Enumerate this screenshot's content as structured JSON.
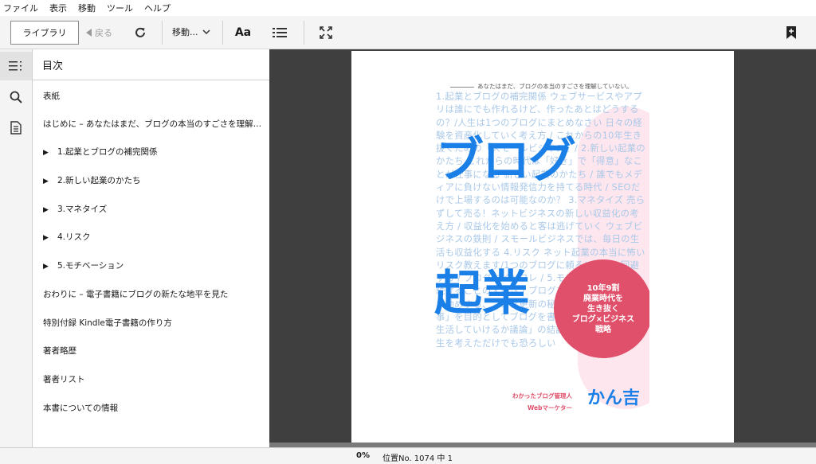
{
  "menubar": {
    "items": [
      "ファイル",
      "表示",
      "移動",
      "ツール",
      "ヘルプ"
    ]
  },
  "toolbar": {
    "library_label": "ライブラリ",
    "back_label": "戻る",
    "goto_label": "移動...",
    "font_label": "Aa",
    "icons": [
      "refresh-icon",
      "chevron-down-icon",
      "font-size-icon",
      "list-view-icon",
      "fullscreen-icon",
      "add-bookmark-icon"
    ]
  },
  "rail": {
    "icons": [
      "toc-icon",
      "search-icon",
      "notes-icon"
    ]
  },
  "toc": {
    "title": "目次",
    "items": [
      {
        "label": "表紙",
        "expandable": false
      },
      {
        "label": "はじめに – あなたはまだ、ブログの本当のすごさを理解してい…",
        "expandable": false
      },
      {
        "label": "1.起業とブログの補完関係",
        "expandable": true
      },
      {
        "label": "2.新しい起業のかたち",
        "expandable": true
      },
      {
        "label": "3.マネタイズ",
        "expandable": true
      },
      {
        "label": "4.リスク",
        "expandable": true
      },
      {
        "label": "5.モチベーション",
        "expandable": true
      },
      {
        "label": "おわりに – 電子書籍にブログの新たな地平を見た",
        "expandable": false
      },
      {
        "label": "特別付録 Kindle電子書籍の作り方",
        "expandable": false
      },
      {
        "label": "著者略歴",
        "expandable": false
      },
      {
        "label": "著者リスト",
        "expandable": false
      },
      {
        "label": "本書についての情報",
        "expandable": false
      }
    ]
  },
  "cover": {
    "tagline": "あなたはまだ、ブログの本当のすごさを理解していない。",
    "background_text": "1.起業とブログの補完関係 ウェブサービスやアプリは誰にでも作れるけど、作ったあとはどうするの？/人生は1つのブログにまとめなさい 日々の経験を資産化していく考え方 / これからの10年生き抜くための「スモールビジネス」/ 2.新しい起業のかたち これからの時代は「好き」で「得意」なことが仕事になる 新しい起業のかたち / 誰でもメディアに負けない情報発信力を持てる時代 / SEOだけで上場するのは可能なのか？ 3.マネタイズ 売らずして売る！ネットビジネスの新しい収益化の考え方 / 収益化を始めると客は逃げていく ウェブビジネスの鉄則 / スモールビジネスでは、毎日の生活も収益化する 4.リスク ネット起業の本当に怖いリスク教えます/1つのブログに頼るリスクを回避する / ブログとインフレ / 5.モチベーション 書き続けることの大切さ / ブログを続けられない人にお勧めする、ブログ更新の秘訣 / 「ブログを書く事」を目的としてブログを書かない / 「ブログで生活していけるか議論」の結論 / ブログがない人生を考えただけでも恐ろしい",
    "title_line1": "ブログ",
    "title_line2": "起業",
    "badge_lines": [
      "10年9割",
      "廃業時代を",
      "生き抜く",
      "ブログ×ビジネス",
      "戦略"
    ],
    "author_role1": "わかったブログ管理人",
    "author_role2": "Webマーケター",
    "author_name": "かん吉",
    "colors": {
      "title_blue": "#1a7fe6",
      "badge_pink": "#e0506b",
      "bg_text": "#a9c8e8"
    }
  },
  "status": {
    "progress": "0%",
    "location": "位置No. 1074 中 1"
  }
}
